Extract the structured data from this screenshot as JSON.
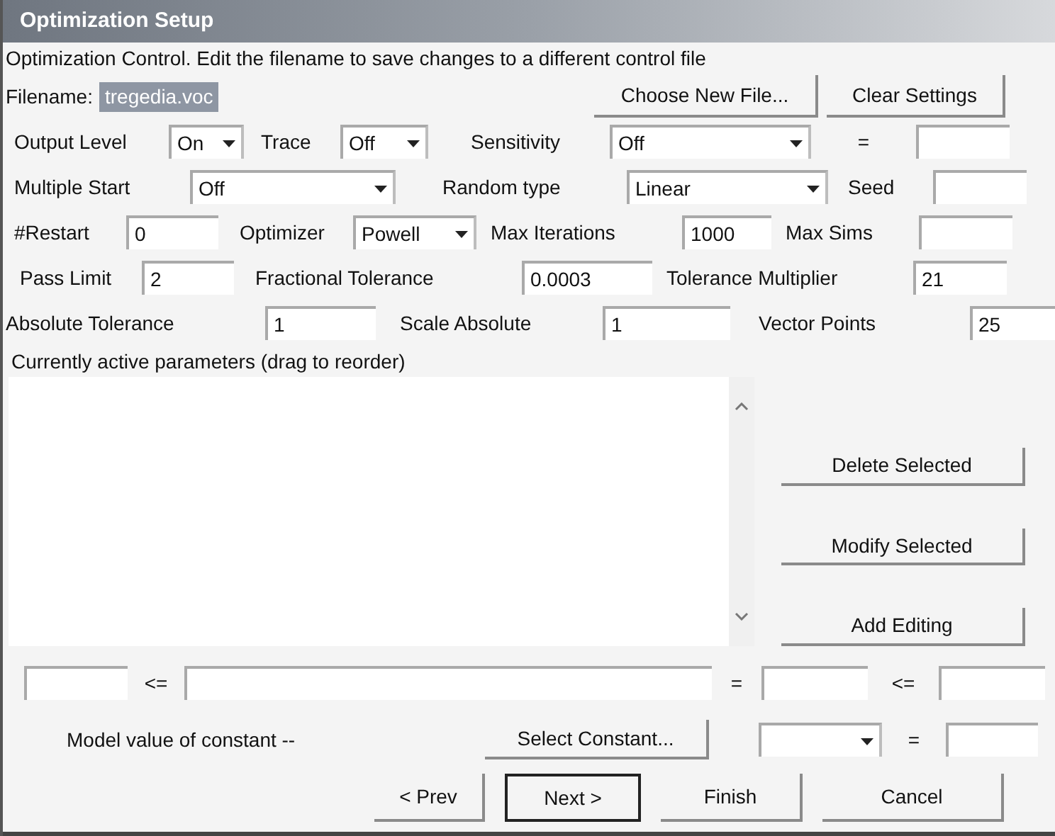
{
  "window": {
    "title": "Optimization Setup"
  },
  "description": "Optimization Control.  Edit the filename to save changes to a different control file",
  "filename": {
    "label": "Filename:",
    "value": "tregedia.voc",
    "highlighted": true
  },
  "file_buttons": [
    "Choose New File...",
    "Clear Settings"
  ],
  "rows": [
    [
      {
        "kind": "label",
        "text": "Output Level"
      },
      {
        "kind": "dropdown",
        "value": "On"
      },
      {
        "kind": "label",
        "text": "Trace"
      },
      {
        "kind": "dropdown",
        "value": "Off"
      },
      {
        "kind": "label",
        "text": "Sensitivity"
      },
      {
        "kind": "dropdown",
        "value": "Off"
      },
      {
        "kind": "label",
        "text": "="
      },
      {
        "kind": "field"
      }
    ],
    [
      {
        "kind": "label",
        "text": "Multiple Start"
      },
      {
        "kind": "dropdown",
        "value": "Off"
      },
      {
        "kind": "label",
        "text": "Random type"
      },
      {
        "kind": "dropdown",
        "value": "Linear"
      },
      {
        "kind": "label",
        "text": "Seed"
      },
      {
        "kind": "field"
      }
    ],
    [
      {
        "kind": "label",
        "text": "#Restart"
      },
      {
        "kind": "field",
        "value": "0"
      },
      {
        "kind": "label",
        "text": "Optimizer"
      },
      {
        "kind": "dropdown",
        "value": "Powell"
      },
      {
        "kind": "label",
        "text": "Max Iterations"
      },
      {
        "kind": "field",
        "value": "1000"
      },
      {
        "kind": "label",
        "text": "Max Sims"
      },
      {
        "kind": "field"
      }
    ],
    [
      {
        "kind": "label",
        "text": "Pass Limit"
      },
      {
        "kind": "field",
        "value": "2"
      },
      {
        "kind": "label",
        "text": "Fractional Tolerance"
      },
      {
        "kind": "field",
        "value": "0.0003"
      },
      {
        "kind": "label",
        "text": "Tolerance Multiplier"
      },
      {
        "kind": "field",
        "value": "21"
      }
    ],
    [
      {
        "kind": "label",
        "text": "Absolute Tolerance"
      },
      {
        "kind": "field",
        "value": "1"
      },
      {
        "kind": "label",
        "text": "Scale Absolute"
      },
      {
        "kind": "field",
        "value": "1"
      },
      {
        "kind": "label",
        "text": "Vector Points"
      },
      {
        "kind": "field",
        "value": "25"
      }
    ]
  ],
  "parameters_label": "Currently active parameters (drag to reorder)",
  "side_buttons": [
    "Delete Selected",
    "Modify Selected",
    "Add Editing"
  ],
  "constraint_row": [
    {
      "kind": "field"
    },
    {
      "kind": "label",
      "text": "<="
    },
    {
      "kind": "field"
    },
    {
      "kind": "label",
      "text": "="
    },
    {
      "kind": "field"
    },
    {
      "kind": "label",
      "text": "<="
    },
    {
      "kind": "field"
    }
  ],
  "constant_row": [
    {
      "kind": "label",
      "text": "Model value of constant --"
    },
    {
      "kind": "button",
      "text": "Select Constant..."
    },
    {
      "kind": "dropdown"
    },
    {
      "kind": "label",
      "text": "="
    },
    {
      "kind": "field"
    }
  ],
  "nav_buttons": [
    {
      "label": "< Prev",
      "default": false
    },
    {
      "label": "Next >",
      "default": true
    },
    {
      "label": "Finish",
      "default": false
    },
    {
      "label": "Cancel",
      "default": false
    }
  ]
}
